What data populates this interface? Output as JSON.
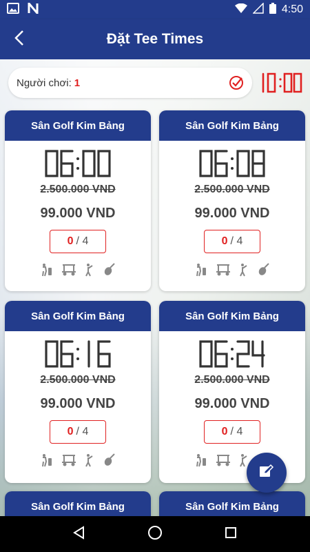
{
  "status_bar": {
    "time": "4:50"
  },
  "header": {
    "title": "Đặt Tee Times"
  },
  "player": {
    "label": "Người chơi:",
    "count": "1"
  },
  "timer": {
    "value": "10:00"
  },
  "cards": [
    {
      "course": "Sân Golf Kim Bảng",
      "time": "06:00",
      "old_price": "2.500.000 VND",
      "new_price": "99.000 VND",
      "booked": "0",
      "capacity": "/ 4"
    },
    {
      "course": "Sân Golf Kim Bảng",
      "time": "06:08",
      "old_price": "2.500.000 VND",
      "new_price": "99.000 VND",
      "booked": "0",
      "capacity": "/ 4"
    },
    {
      "course": "Sân Golf Kim Bảng",
      "time": "06:16",
      "old_price": "2.500.000 VND",
      "new_price": "99.000 VND",
      "booked": "0",
      "capacity": "/ 4"
    },
    {
      "course": "Sân Golf Kim Bảng",
      "time": "06:24",
      "old_price": "2.500.000 VND",
      "new_price": "99.000 VND",
      "booked": "0",
      "capacity": "/ 4"
    },
    {
      "course": "Sân Golf Kim Bảng"
    },
    {
      "course": "Sân Golf Kim Bảng"
    }
  ],
  "colors": {
    "primary": "#233c8c",
    "accent_red": "#e02020",
    "text": "#444444"
  },
  "icons": [
    "image-icon",
    "notification-n-icon",
    "wifi-icon",
    "signal-icon",
    "battery-icon",
    "back-arrow-icon",
    "check-circle-icon",
    "golfer-bag-icon",
    "golf-cart-icon",
    "caddie-icon",
    "golf-club-icon",
    "edit-icon",
    "nav-back-icon",
    "nav-home-icon",
    "nav-recents-icon"
  ]
}
